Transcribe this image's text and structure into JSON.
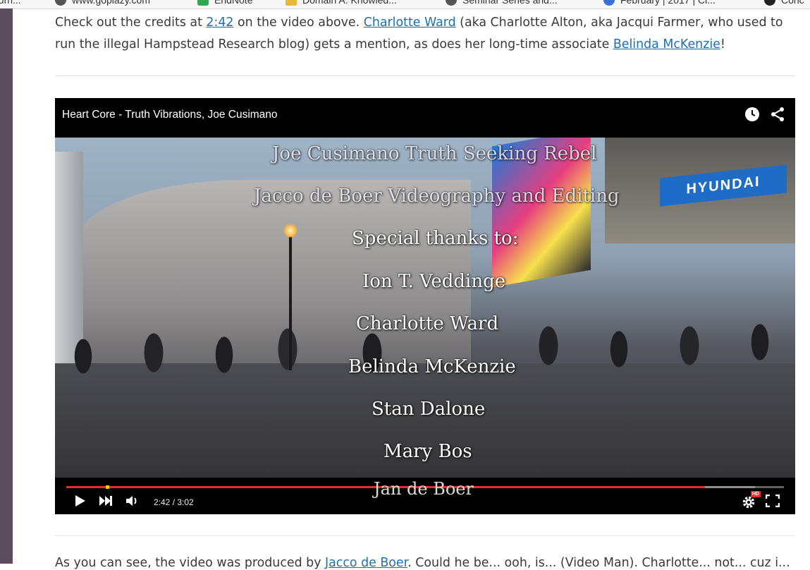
{
  "bookmarks": [
    {
      "label": "ourn...",
      "icon": "globe-icon",
      "color": "#555555"
    },
    {
      "label": "www.goplazy.com",
      "icon": "globe-icon",
      "color": "#555555"
    },
    {
      "label": "EndNote",
      "icon": "endnote-icon",
      "color": "#2fa84f"
    },
    {
      "label": "Domain A: Knowled...",
      "icon": "folder-icon",
      "color": "#333333"
    },
    {
      "label": "Seminar Series and...",
      "icon": "globe-icon",
      "color": "#555555"
    },
    {
      "label": "February | 2017 | Cl...",
      "icon": "wordpress-icon",
      "color": "#3a6fd8"
    },
    {
      "label": "Conc",
      "icon": "globe-icon",
      "color": "#222222"
    }
  ],
  "article": {
    "para1_prefix": "Check out the credits at ",
    "para1_link_time": "2:42",
    "para1_mid": " on the video above. ",
    "para1_link_charlotte": "Charlotte Ward",
    "para1_rest": " (aka Charlotte Alton, aka Jacqui Farmer, who used to run the illegal Hampstead Research blog) gets a mention, as does her long-time associate ",
    "para1_link_belinda": "Belinda McKenzie",
    "para1_end": "!",
    "para2_prefix": "As you can see, the video was produced by ",
    "para2_link": "Jacco de Boer",
    "para2_rest": ". Could he be... ooh, is... (Video Man). Charlotte... not... cuz i..."
  },
  "video": {
    "title": "Heart Core - Truth Vibrations, Joe Cusimano",
    "timecode": "2:42 / 3:02",
    "progress_played": 0.89,
    "progress_loaded": 0.96,
    "hd_badge": "HD",
    "billboard": "HYUNDAI",
    "credits": [
      "Joe Cusimano   Truth Seeking Rebel",
      "Jacco de Boer   Videography and Editing",
      "Special thanks to:",
      "Ion T. Veddinge",
      "Charlotte Ward",
      "Belinda McKenzie",
      "Stan Dalone",
      "Mary Bos",
      "Jan de Boer"
    ]
  },
  "colors": {
    "link": "#1f6fae",
    "progress_red": "#e52d27",
    "text": "#3a3a3a"
  }
}
